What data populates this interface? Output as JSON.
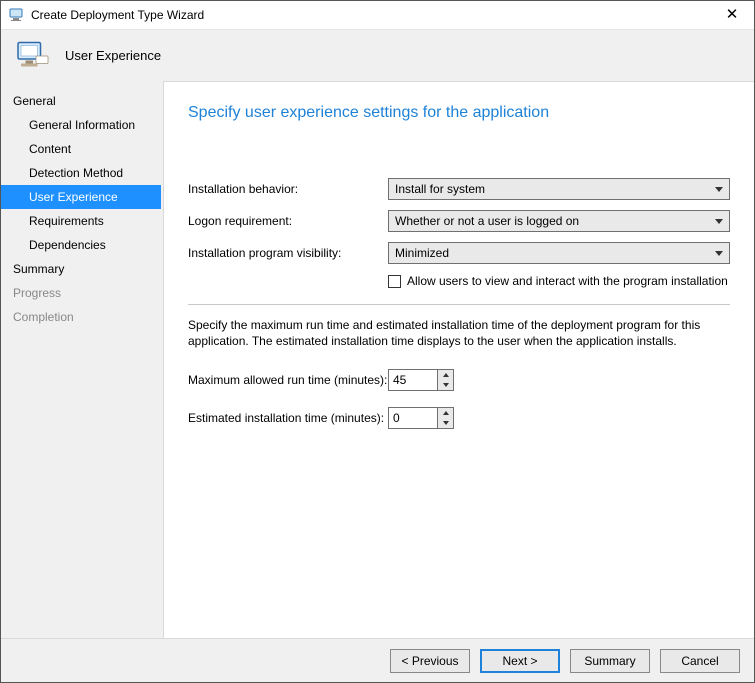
{
  "window": {
    "title": "Create Deployment Type Wizard"
  },
  "banner": {
    "title": "User Experience"
  },
  "sidebar": {
    "items": [
      {
        "label": "General",
        "type": "group"
      },
      {
        "label": "General Information",
        "type": "sub"
      },
      {
        "label": "Content",
        "type": "sub"
      },
      {
        "label": "Detection Method",
        "type": "sub"
      },
      {
        "label": "User Experience",
        "type": "sub",
        "selected": true
      },
      {
        "label": "Requirements",
        "type": "sub"
      },
      {
        "label": "Dependencies",
        "type": "sub"
      },
      {
        "label": "Summary",
        "type": "group"
      },
      {
        "label": "Progress",
        "type": "group",
        "disabled": true
      },
      {
        "label": "Completion",
        "type": "group",
        "disabled": true
      }
    ]
  },
  "page": {
    "heading": "Specify user experience settings for the application",
    "form": {
      "install_behavior_label": "Installation behavior:",
      "install_behavior_value": "Install for system",
      "logon_req_label": "Logon requirement:",
      "logon_req_value": "Whether or not a user is logged on",
      "visibility_label": "Installation program visibility:",
      "visibility_value": "Minimized",
      "allow_interact_label": "Allow users to view and interact with the program installation"
    },
    "times": {
      "desc": "Specify the maximum run time and estimated installation time of the deployment program for this application. The estimated installation time displays to the user when the application installs.",
      "max_label": "Maximum allowed run time (minutes):",
      "max_value": "45",
      "est_label": "Estimated installation time (minutes):",
      "est_value": "0"
    }
  },
  "footer": {
    "previous": "< Previous",
    "next": "Next >",
    "summary": "Summary",
    "cancel": "Cancel"
  }
}
